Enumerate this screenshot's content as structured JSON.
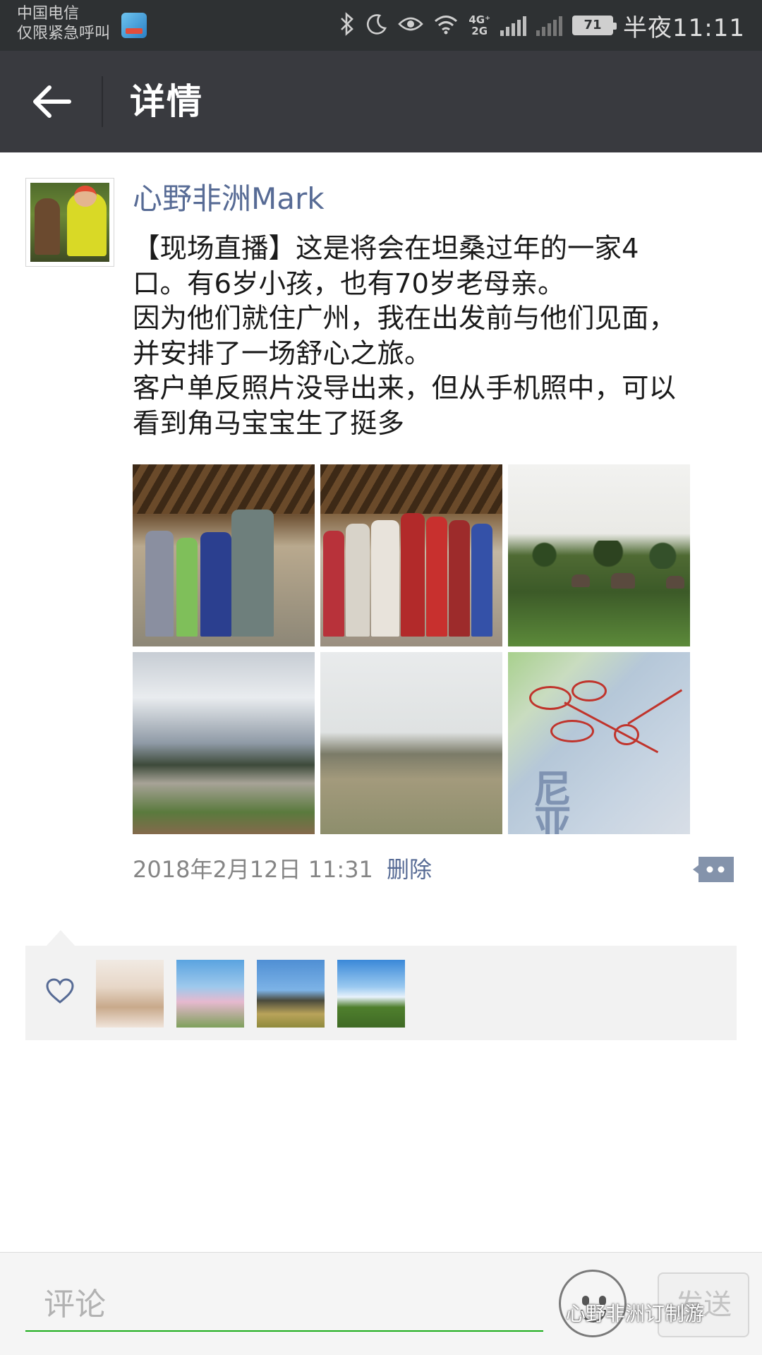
{
  "status_bar": {
    "carrier": "中国电信",
    "emergency": "仅限紧急呼叫",
    "network_4g": "4G⁺",
    "network_2g": "2G",
    "battery": "71",
    "time": "半夜11:11"
  },
  "header": {
    "title": "详情"
  },
  "post": {
    "author": "心野非洲Mark",
    "text_lines": [
      "【现场直播】这是将会在坦桑过年的一家4",
      "口。有6岁小孩，也有70岁老母亲。",
      "因为他们就住广州，我在出发前与他们见面，",
      "并安排了一场舒心之旅。",
      "客户单反照片没导出来，但从手机照中，可以",
      "看到角马宝宝生了挺多"
    ],
    "timestamp": "2018年2月12日 11:31",
    "delete_label": "删除",
    "map_text_1": "尼",
    "map_text_2": "亚"
  },
  "likes": {
    "count": 4
  },
  "comment_bar": {
    "placeholder": "评论",
    "send_label": "发送"
  },
  "watermark": "心野非洲订制游",
  "colors": {
    "status_bar": "#2e3133",
    "title_bar": "#393a3f",
    "link": "#576b95",
    "input_underline": "#1aad19"
  }
}
